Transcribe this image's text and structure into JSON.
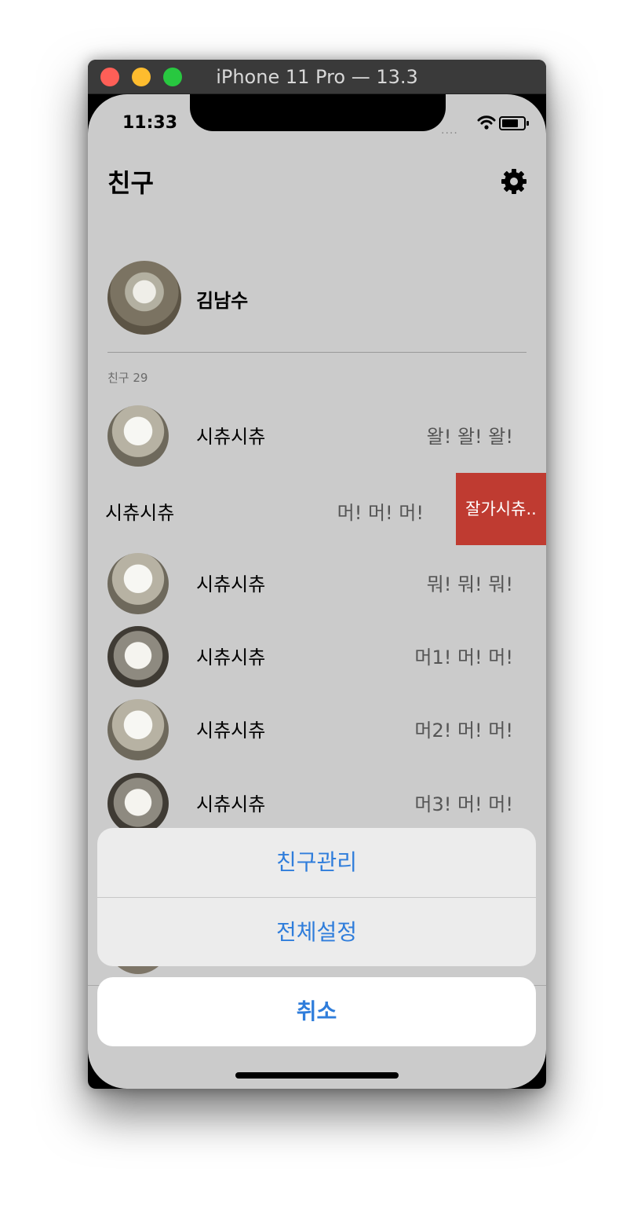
{
  "window": {
    "title": "iPhone 11 Pro — 13.3"
  },
  "status_bar": {
    "time": "11:33",
    "signal": "....",
    "wifi_icon": "wifi-icon",
    "battery_icon": "battery-icon"
  },
  "nav": {
    "title": "친구",
    "settings_icon": "gear-icon"
  },
  "profile": {
    "name": "김남수"
  },
  "friends": {
    "section_header": "친구 29",
    "rows": [
      {
        "name": "시츄시츄",
        "status": "왈! 왈! 왈!"
      },
      {
        "name": "시츄시츄",
        "status": "머! 머! 머!",
        "swipe_action": "잘가시츄.."
      },
      {
        "name": "시츄시츄",
        "status": "뭐! 뭐! 뭐!"
      },
      {
        "name": "시츄시츄",
        "status": "머1! 머! 머!"
      },
      {
        "name": "시츄시츄",
        "status": "머2! 머! 머!"
      },
      {
        "name": "시츄시츄",
        "status": "머3! 머! 머!"
      }
    ]
  },
  "action_sheet": {
    "actions": [
      "친구관리",
      "전체설정"
    ],
    "cancel_label": "취소",
    "accent_color": "#2f7ddb",
    "destructive_color": "#bf3b31"
  }
}
